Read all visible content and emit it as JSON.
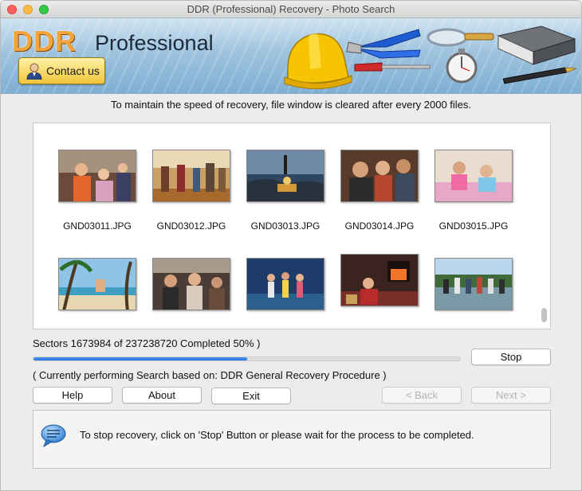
{
  "window": {
    "title": "DDR (Professional) Recovery - Photo Search"
  },
  "banner": {
    "logo_ddr": "DDR",
    "logo_professional": "Professional",
    "contact_label": "Contact us"
  },
  "info_line": "To maintain the speed of recovery, file window is cleared after every 2000 files.",
  "files": {
    "row1": [
      "GND03011.JPG",
      "GND03012.JPG",
      "GND03013.JPG",
      "GND03014.JPG",
      "GND03015.JPG"
    ],
    "row2": [
      "",
      "",
      "",
      "",
      ""
    ]
  },
  "status": {
    "sectors_text": "Sectors 1673984 of  237238720  Completed 50% )",
    "progress": 0.5,
    "procedure_text": "( Currently performing Search based on: DDR General Recovery Procedure )"
  },
  "buttons": {
    "stop": "Stop",
    "help": "Help",
    "about": "About",
    "exit": "Exit",
    "back": "< Back",
    "next": "Next >"
  },
  "message": "To stop recovery, click on 'Stop' Button or please wait for the process to be completed.",
  "colors": {
    "progress_fill": "#2a73e0",
    "logo_orange": "#f2a33a",
    "contact_gold": "#f1c53a"
  }
}
